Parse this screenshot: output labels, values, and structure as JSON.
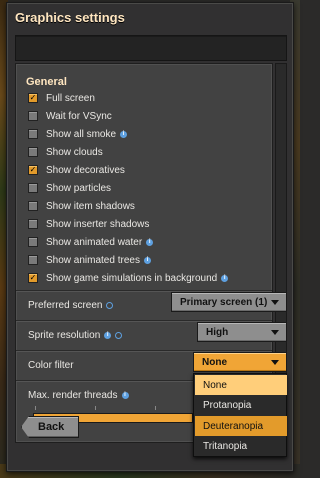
{
  "window": {
    "title": "Graphics settings"
  },
  "general": {
    "heading": "General",
    "options": [
      {
        "label": "Full screen",
        "checked": true,
        "info": false
      },
      {
        "label": "Wait for VSync",
        "checked": false,
        "info": false
      },
      {
        "label": "Show all smoke",
        "checked": false,
        "info": true
      },
      {
        "label": "Show clouds",
        "checked": false,
        "info": false
      },
      {
        "label": "Show decoratives",
        "checked": true,
        "info": false
      },
      {
        "label": "Show particles",
        "checked": false,
        "info": false
      },
      {
        "label": "Show item shadows",
        "checked": false,
        "info": false
      },
      {
        "label": "Show inserter shadows",
        "checked": false,
        "info": false
      },
      {
        "label": "Show animated water",
        "checked": false,
        "info": true
      },
      {
        "label": "Show animated trees",
        "checked": false,
        "info": true
      },
      {
        "label": "Show game simulations in background",
        "checked": true,
        "info": true
      }
    ]
  },
  "preferred_screen": {
    "label": "Preferred screen",
    "value": "Primary screen (1)"
  },
  "sprite_resolution": {
    "label": "Sprite resolution",
    "value": "High"
  },
  "color_filter": {
    "label": "Color filter",
    "value": "None",
    "options": [
      "None",
      "Protanopia",
      "Deuteranopia",
      "Tritanopia"
    ],
    "selected_index": 0,
    "hover_index": 2
  },
  "render_threads": {
    "label": "Max. render threads"
  },
  "buttons": {
    "back": "Back"
  },
  "colors": {
    "accent": "#f0a536",
    "checkbox_checked": "#e39b2b",
    "info": "#5ea0e0",
    "title": "#ffe6c0"
  }
}
